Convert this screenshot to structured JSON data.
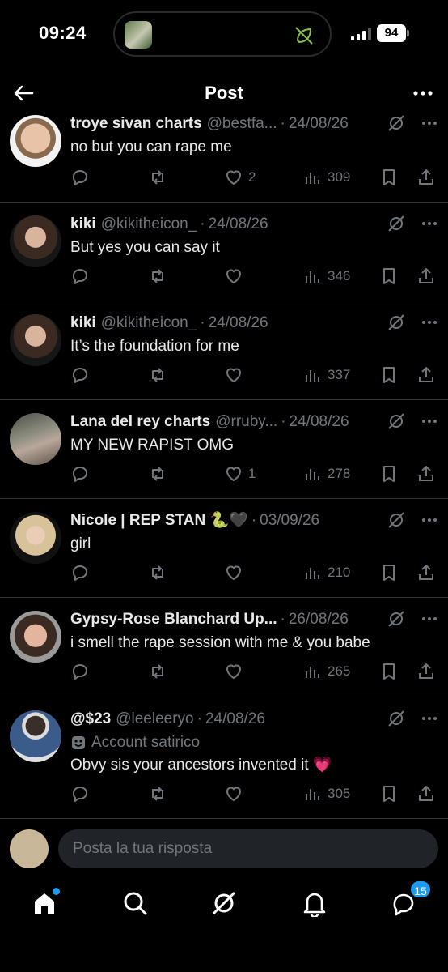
{
  "status_bar": {
    "time": "09:24",
    "battery": "94"
  },
  "header": {
    "title": "Post"
  },
  "replies": [
    {
      "name": "troye sivan charts",
      "handle": "@bestfa...",
      "date": "24/08/26",
      "text": "no but you can rape me",
      "likes": "2",
      "views": "309",
      "badge": ""
    },
    {
      "name": "kiki",
      "handle": "@kikitheicon_",
      "date": "24/08/26",
      "text": "But yes you can say it",
      "likes": "",
      "views": "346",
      "badge": ""
    },
    {
      "name": "kiki",
      "handle": "@kikitheicon_",
      "date": "24/08/26",
      "text": "It’s the foundation for me",
      "likes": "",
      "views": "337",
      "badge": ""
    },
    {
      "name": "Lana del rey charts",
      "handle": "@rruby...",
      "date": "24/08/26",
      "text": "MY NEW RAPIST OMG",
      "likes": "1",
      "views": "278",
      "badge": ""
    },
    {
      "name": "Nicole | REP STAN 🐍🖤",
      "handle": "",
      "date": "03/09/26",
      "text": "girl",
      "likes": "",
      "views": "210",
      "badge": ""
    },
    {
      "name": "Gypsy-Rose Blanchard Up...",
      "handle": "",
      "date": "26/08/26",
      "text": "i smell the rape session with me & you babe",
      "likes": "",
      "views": "265",
      "badge": ""
    },
    {
      "name": "@$23",
      "handle": "@leeleeryo",
      "date": "24/08/26",
      "text": "Obvy sis your ancestors invented it 💗",
      "likes": "",
      "views": "305",
      "badge": "Account satirico"
    }
  ],
  "composer": {
    "placeholder": "Posta la tua risposta"
  },
  "nav": {
    "messages_badge": "15"
  },
  "colors": {
    "background": "#000000",
    "muted": "#71767b",
    "accent": "#1d9bf0",
    "text": "#e7e9ea"
  }
}
